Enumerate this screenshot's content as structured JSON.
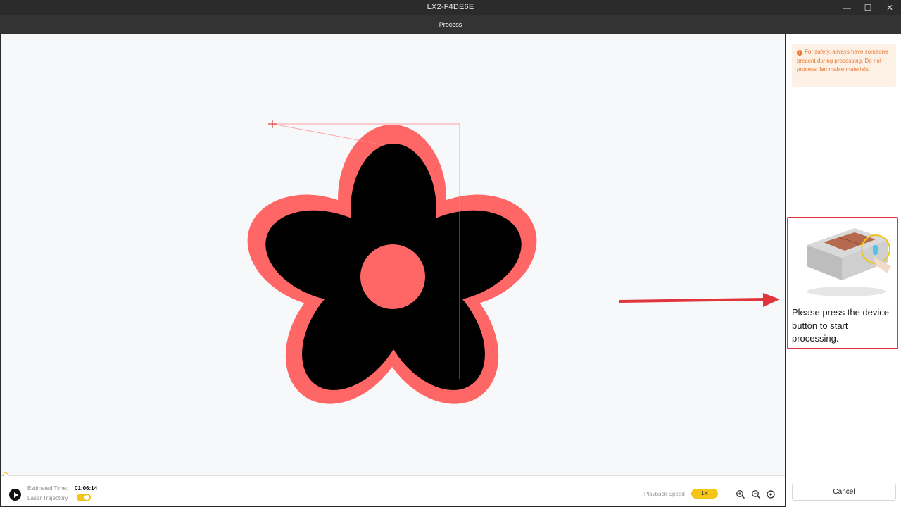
{
  "window": {
    "title": "LX2-F4DE6E",
    "minimize_glyph": "—",
    "maximize_glyph": "☐",
    "close_glyph": "✕"
  },
  "header": {
    "section_label": "Process"
  },
  "preview": {
    "shape": "five-petal-flower",
    "fill_color": "#000000",
    "outline_color": "#ff6666",
    "center_color": "#ff6666",
    "origin_marker": "crosshair-icon"
  },
  "playback": {
    "progress": 0,
    "estimated_time_label": "Estimated Time:",
    "estimated_time_value": "01:06:14",
    "laser_trajectory_label": "Laser Trajectory",
    "laser_trajectory_on": true,
    "speed_label": "Playback Speed",
    "speed_value": "1X",
    "icons": [
      "play-icon",
      "zoom-in-icon",
      "zoom-out-icon",
      "fit-view-icon"
    ]
  },
  "sidebar": {
    "safety_notice": "For safety, always have someone present during processing. Do not process flammable materials.",
    "prompt_text": "Please press the device button to start processing.",
    "cancel_label": "Cancel"
  },
  "colors": {
    "accent": "#f5c518",
    "highlight_border": "#e0353c",
    "warning_text": "#e87a35",
    "warning_bg": "#fdf1e6"
  }
}
